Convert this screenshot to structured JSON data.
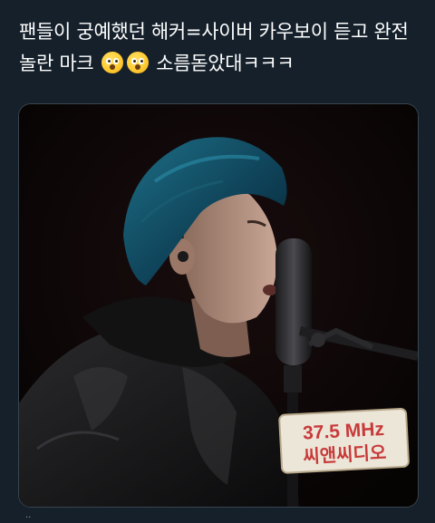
{
  "tweet": {
    "text_part1": "팬들이 궁예했던 해커=사이버 카우보이 듣고 완전 놀란 마크 ",
    "text_part2": " 소름돋았대ㅋㅋㅋ",
    "emojis": [
      "astonished-face",
      "astonished-face"
    ]
  },
  "media": {
    "badge_top": "37.5 MHz",
    "badge_bottom": "씨앤씨디오"
  },
  "footer": {
    "hint": "··"
  }
}
